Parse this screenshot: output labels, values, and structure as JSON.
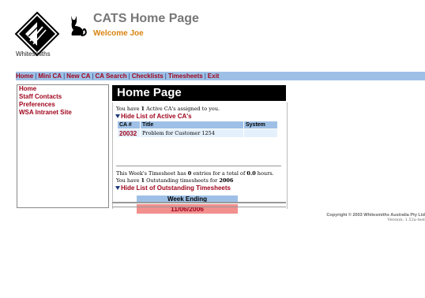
{
  "header": {
    "title": "CATS Home Page",
    "welcome": "Welcome Joe",
    "logo_text": "Whitesmiths"
  },
  "nav": {
    "items": [
      "Home",
      "Mini CA",
      "New CA",
      "CA Search",
      "Checklists",
      "Timesheets",
      "Exit"
    ]
  },
  "sidebar": {
    "items": [
      "Home",
      "Staff Contacts",
      "Preferences",
      "WSA Intranet Site"
    ]
  },
  "main": {
    "heading": "Home Page",
    "active_ca_prefix": "You have ",
    "active_ca_count": "1",
    "active_ca_suffix": " Active CA's assigned to you.",
    "hide_active_label": "Hide List of Active CA's",
    "ca_table": {
      "headers": [
        "CA #",
        "Title",
        "System"
      ],
      "rows": [
        {
          "ca": "20032",
          "title": "Problem for Customer 1254",
          "system": ""
        }
      ]
    },
    "timesheet_line1_a": "This Week's Timesheet has ",
    "timesheet_entries": "0",
    "timesheet_line1_b": " entries for a total of ",
    "timesheet_hours": "0.0",
    "timesheet_line1_c": " hours.",
    "outstanding_a": "You have ",
    "outstanding_count": "1",
    "outstanding_b": " Outstanding timesheets for ",
    "outstanding_year": "2006",
    "hide_outstanding_label": "Hide List of Outstanding Timesheets",
    "week_ending_header": "Week Ending",
    "week_ending_value": "11/06/2006"
  },
  "footer": {
    "copyright": "Copyright © 2003 Whitesmiths Australia Pty Ltd",
    "version": "Version: 1.52a-test"
  },
  "colors": {
    "nav_bg": "#9ec0e6",
    "link": "#a0061e",
    "welcome": "#d9830f",
    "highlight_row": "#f2908e"
  }
}
